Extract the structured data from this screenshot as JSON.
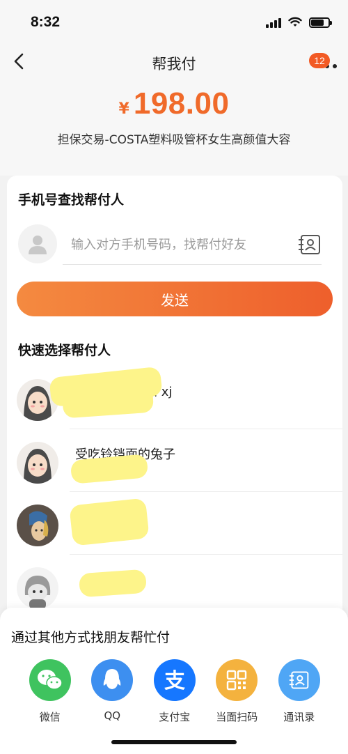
{
  "status_bar": {
    "time": "8:32"
  },
  "nav": {
    "title": "帮我付",
    "badge_count": "12"
  },
  "payment": {
    "currency_symbol": "¥",
    "amount": "198.00",
    "description": "担保交易-COSTA塑料吸管杯女生高颜值大容"
  },
  "phone_search": {
    "title": "手机号查找帮付人",
    "placeholder": "输入对方手机号码，找帮付好友",
    "send_label": "发送"
  },
  "quick_select": {
    "title": "快速选择帮付人",
    "friends": [
      {
        "name": "备加 xj",
        "sub": ""
      },
      {
        "name": "受吃铃铛面的兔子",
        "sub": ""
      },
      {
        "name": "",
        "sub": ""
      },
      {
        "name": "",
        "sub": ""
      }
    ]
  },
  "share": {
    "title": "通过其他方式找朋友帮忙付",
    "options": [
      {
        "label": "微信",
        "icon": "wechat-icon",
        "color": "#3fc35f"
      },
      {
        "label": "QQ",
        "icon": "qq-icon",
        "color": "#3d8ff0"
      },
      {
        "label": "支付宝",
        "icon": "alipay-icon",
        "color": "#1677ff"
      },
      {
        "label": "当面扫码",
        "icon": "qr-code-icon",
        "color": "#f4b23e"
      },
      {
        "label": "通讯录",
        "icon": "contacts-icon",
        "color": "#4fa6f5"
      }
    ]
  },
  "colors": {
    "accent": "#f06a2a",
    "button_gradient_start": "#f48a40",
    "button_gradient_end": "#ee5f2c"
  }
}
